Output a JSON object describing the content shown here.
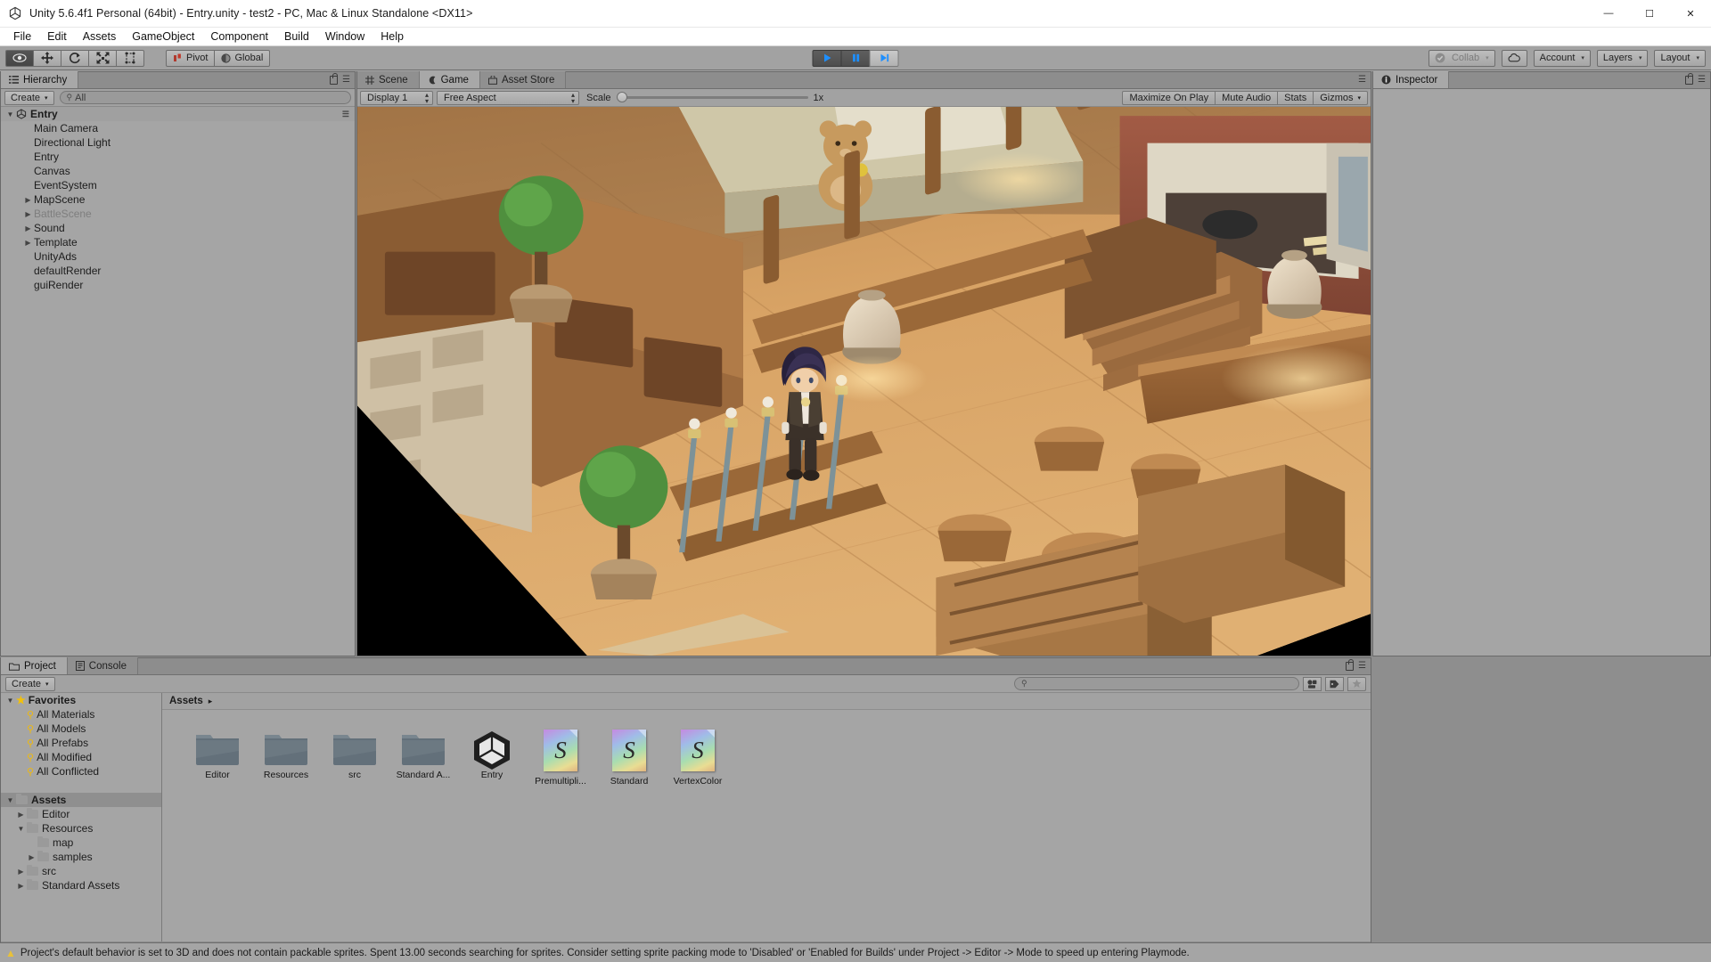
{
  "window": {
    "title": "Unity 5.6.4f1 Personal (64bit) - Entry.unity - test2 - PC, Mac & Linux Standalone <DX11>",
    "minimize": "—",
    "maximize": "☐",
    "close": "✕"
  },
  "menubar": {
    "items": [
      "File",
      "Edit",
      "Assets",
      "GameObject",
      "Component",
      "Build",
      "Window",
      "Help"
    ]
  },
  "toolbar": {
    "transform_tools": [
      {
        "name": "hand-tool",
        "active": true
      },
      {
        "name": "move-tool",
        "active": false
      },
      {
        "name": "rotate-tool",
        "active": false
      },
      {
        "name": "scale-tool",
        "active": false
      },
      {
        "name": "rect-tool",
        "active": false
      }
    ],
    "pivot_label": "Pivot",
    "global_label": "Global",
    "play_label": "Play",
    "pause_label": "Pause",
    "step_label": "Step",
    "collab_label": "Collab",
    "cloud_label": "Cloud Services",
    "account_label": "Account",
    "layers_label": "Layers",
    "layout_label": "Layout",
    "caret": "▾",
    "accent_blue": "#2196f3"
  },
  "hierarchy": {
    "tab_label": "Hierarchy",
    "create_label": "Create",
    "create_caret": "▾",
    "search_value": "",
    "search_placeholder": "All",
    "root": {
      "label": "Entry",
      "expanded": true
    },
    "items": [
      {
        "label": "Main Camera",
        "depth": 1,
        "expandable": false,
        "dim": false
      },
      {
        "label": "Directional Light",
        "depth": 1,
        "expandable": false,
        "dim": false
      },
      {
        "label": "Entry",
        "depth": 1,
        "expandable": false,
        "dim": false
      },
      {
        "label": "Canvas",
        "depth": 1,
        "expandable": false,
        "dim": false
      },
      {
        "label": "EventSystem",
        "depth": 1,
        "expandable": false,
        "dim": false
      },
      {
        "label": "MapScene",
        "depth": 1,
        "expandable": true,
        "dim": false
      },
      {
        "label": "BattleScene",
        "depth": 1,
        "expandable": true,
        "dim": true
      },
      {
        "label": "Sound",
        "depth": 1,
        "expandable": true,
        "dim": false
      },
      {
        "label": "Template",
        "depth": 1,
        "expandable": true,
        "dim": false
      },
      {
        "label": "UnityAds",
        "depth": 1,
        "expandable": false,
        "dim": false
      },
      {
        "label": "defaultRender",
        "depth": 1,
        "expandable": false,
        "dim": false
      },
      {
        "label": "guiRender",
        "depth": 1,
        "expandable": false,
        "dim": false
      }
    ]
  },
  "gameview": {
    "tabs": [
      {
        "label": "Scene",
        "icon": "grid-icon",
        "active": false
      },
      {
        "label": "Game",
        "icon": "gamepad-icon",
        "active": true
      },
      {
        "label": "Asset Store",
        "icon": "store-icon",
        "active": false
      }
    ],
    "display_label": "Display 1",
    "aspect_label": "Free Aspect",
    "scale_label": "Scale",
    "scale_value": "1x",
    "maximize_label": "Maximize On Play",
    "mute_label": "Mute Audio",
    "stats_label": "Stats",
    "gizmos_label": "Gizmos",
    "gizmos_caret": "▾",
    "scene_description": "Isometric 3D tavern interior with wooden floor, character, fences, barrels and furniture"
  },
  "inspector": {
    "tab_label": "Inspector",
    "icon": "info-icon"
  },
  "project": {
    "tabs": [
      {
        "label": "Project",
        "icon": "folder-icon",
        "active": true
      },
      {
        "label": "Console",
        "icon": "console-icon",
        "active": false
      }
    ],
    "create_label": "Create",
    "create_caret": "▾",
    "search_value": "",
    "tree": [
      {
        "label": "Favorites",
        "depth": 0,
        "type": "star",
        "expanded": true,
        "selected": false
      },
      {
        "label": "All Materials",
        "depth": 1,
        "type": "search",
        "expanded": null,
        "selected": false
      },
      {
        "label": "All Models",
        "depth": 1,
        "type": "search",
        "expanded": null,
        "selected": false
      },
      {
        "label": "All Prefabs",
        "depth": 1,
        "type": "search",
        "expanded": null,
        "selected": false
      },
      {
        "label": "All Modified",
        "depth": 1,
        "type": "search",
        "expanded": null,
        "selected": false
      },
      {
        "label": "All Conflicted",
        "depth": 1,
        "type": "search",
        "expanded": null,
        "selected": false
      },
      {
        "label": "",
        "depth": 0,
        "type": "spacer",
        "expanded": null,
        "selected": false
      },
      {
        "label": "Assets",
        "depth": 0,
        "type": "folder",
        "expanded": true,
        "selected": true
      },
      {
        "label": "Editor",
        "depth": 1,
        "type": "folder",
        "expanded": false,
        "selected": false
      },
      {
        "label": "Resources",
        "depth": 1,
        "type": "folder",
        "expanded": true,
        "selected": false
      },
      {
        "label": "map",
        "depth": 2,
        "type": "folder",
        "expanded": null,
        "selected": false
      },
      {
        "label": "samples",
        "depth": 2,
        "type": "folder",
        "expanded": false,
        "selected": false
      },
      {
        "label": "src",
        "depth": 1,
        "type": "folder",
        "expanded": false,
        "selected": false
      },
      {
        "label": "Standard Assets",
        "depth": 1,
        "type": "folder",
        "expanded": false,
        "selected": false
      }
    ],
    "breadcrumb": "Assets",
    "breadcrumb_caret": "▸",
    "assets": [
      {
        "label": "Editor",
        "kind": "folder"
      },
      {
        "label": "Resources",
        "kind": "folder"
      },
      {
        "label": "src",
        "kind": "folder"
      },
      {
        "label": "Standard A...",
        "kind": "folder"
      },
      {
        "label": "Entry",
        "kind": "unity-scene"
      },
      {
        "label": "Premultipli...",
        "kind": "material"
      },
      {
        "label": "Standard",
        "kind": "material"
      },
      {
        "label": "VertexColor",
        "kind": "material"
      }
    ]
  },
  "statusbar": {
    "icon": "warning-icon",
    "message": "Project's default behavior is set to 3D and does not contain packable sprites. Spent 13.00 seconds searching for sprites. Consider setting sprite packing mode to 'Disabled' or 'Enabled for Builds' under Project -> Editor -> Mode to speed up entering Playmode."
  }
}
